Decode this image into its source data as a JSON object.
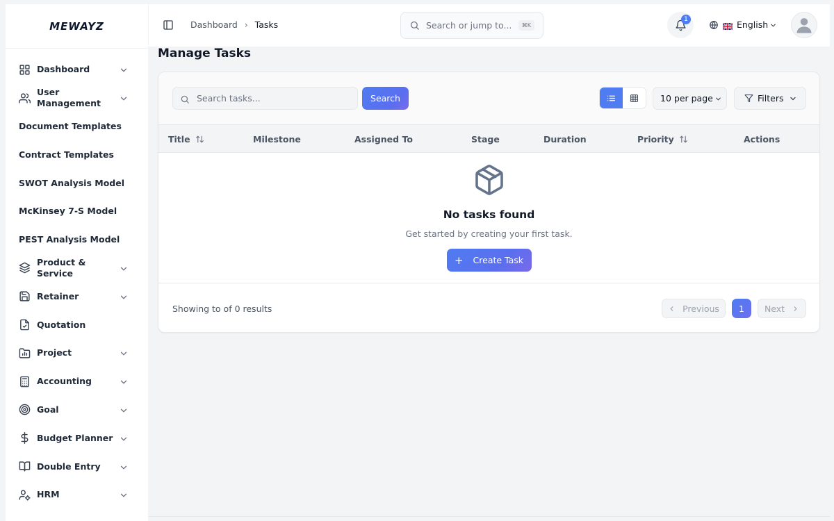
{
  "brand": {
    "name": "MEWAYZ"
  },
  "sidebar": {
    "items": [
      {
        "label": "Dashboard",
        "icon": "grid-icon",
        "has_chevron": true
      },
      {
        "label": "User\nManagement",
        "icon": "users-icon",
        "has_chevron": true
      },
      {
        "label": "Document Templates",
        "icon": "",
        "has_chevron": false
      },
      {
        "label": "Contract Templates",
        "icon": "",
        "has_chevron": false
      },
      {
        "label": "SWOT Analysis Model",
        "icon": "",
        "has_chevron": false
      },
      {
        "label": "McKinsey 7-S Model",
        "icon": "",
        "has_chevron": false
      },
      {
        "label": "PEST Analysis Model",
        "icon": "",
        "has_chevron": false
      },
      {
        "label": "Product &\nService",
        "icon": "layers-icon",
        "has_chevron": true
      },
      {
        "label": "Retainer",
        "icon": "save-icon",
        "has_chevron": true
      },
      {
        "label": "Quotation",
        "icon": "file-check-icon",
        "has_chevron": false
      },
      {
        "label": "Project",
        "icon": "folder-chart-icon",
        "has_chevron": true
      },
      {
        "label": "Accounting",
        "icon": "calculator-icon",
        "has_chevron": true
      },
      {
        "label": "Goal",
        "icon": "target-icon",
        "has_chevron": true
      },
      {
        "label": "Budget Planner",
        "icon": "dollar-icon",
        "has_chevron": true
      },
      {
        "label": "Double Entry",
        "icon": "book-open-icon",
        "has_chevron": true
      },
      {
        "label": "HRM",
        "icon": "user-cog-icon",
        "has_chevron": true
      }
    ]
  },
  "topbar": {
    "breadcrumb": [
      "Dashboard",
      "Tasks"
    ],
    "search_placeholder": "Search or jump to...",
    "search_shortcut": "⌘K",
    "notification_count": "1",
    "language": "English"
  },
  "page": {
    "title": "Manage Tasks"
  },
  "toolbar": {
    "search_placeholder": "Search tasks...",
    "search_button": "Search",
    "per_page": "10 per page",
    "filters": "Filters",
    "active_view": "list"
  },
  "table": {
    "columns": [
      {
        "label": "Title",
        "sortable": true
      },
      {
        "label": "Milestone",
        "sortable": false
      },
      {
        "label": "Assigned To",
        "sortable": false
      },
      {
        "label": "Stage",
        "sortable": false
      },
      {
        "label": "Duration",
        "sortable": false
      },
      {
        "label": "Priority",
        "sortable": true
      },
      {
        "label": "Actions",
        "sortable": false
      }
    ]
  },
  "empty_state": {
    "icon": "package-icon",
    "title": "No tasks found",
    "subtitle": "Get started by creating your first task.",
    "button": "Create Task"
  },
  "footer": {
    "results_text": "Showing to of 0 results",
    "prev": "Previous",
    "current_page": "1",
    "next": "Next"
  },
  "colors": {
    "accent": "#4f7cf0",
    "accent_gradient_end": "#7a6ae8",
    "text_primary": "#111827",
    "text_muted": "#6b7280"
  }
}
